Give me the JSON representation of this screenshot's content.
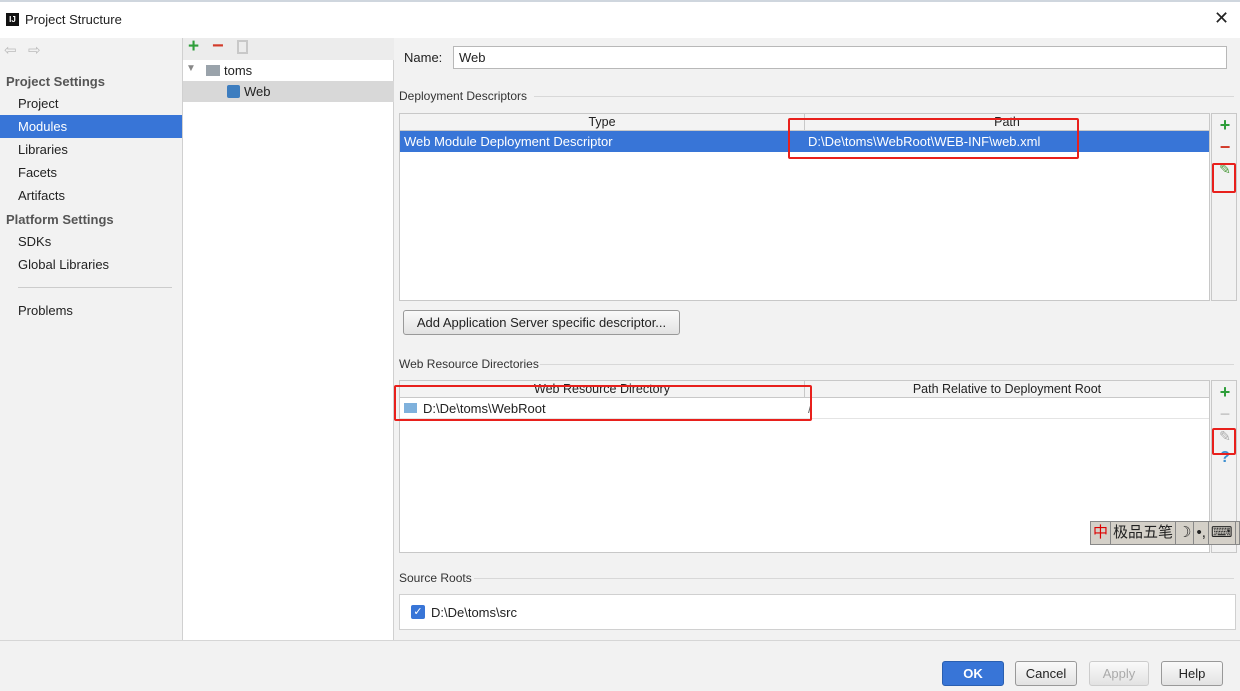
{
  "window": {
    "title": "Project Structure"
  },
  "sidebar": {
    "project_settings_header": "Project Settings",
    "project_items": [
      {
        "label": "Project"
      },
      {
        "label": "Modules",
        "selected": true
      },
      {
        "label": "Libraries"
      },
      {
        "label": "Facets"
      },
      {
        "label": "Artifacts"
      }
    ],
    "platform_settings_header": "Platform Settings",
    "platform_items": [
      {
        "label": "SDKs"
      },
      {
        "label": "Global Libraries"
      }
    ],
    "problems": "Problems"
  },
  "tree": {
    "root": "toms",
    "child": "Web"
  },
  "main": {
    "name_label": "Name:",
    "name_value": "Web",
    "deployment": {
      "header": "Deployment Descriptors",
      "columns": [
        "Type",
        "Path"
      ],
      "rows": [
        {
          "type": "Web Module Deployment Descriptor",
          "path": "D:\\De\\toms\\WebRoot\\WEB-INF\\web.xml"
        }
      ],
      "add_server_button": "Add Application Server specific descriptor..."
    },
    "resources": {
      "header": "Web Resource Directories",
      "columns": [
        "Web Resource Directory",
        "Path Relative to Deployment Root"
      ],
      "rows": [
        {
          "dir": "D:\\De\\toms\\WebRoot",
          "relative": "/"
        }
      ]
    },
    "source_roots": {
      "header": "Source Roots",
      "items": [
        {
          "path": "D:\\De\\toms\\src",
          "checked": true
        }
      ]
    }
  },
  "ime": {
    "items": [
      "中",
      "极品五笔",
      "☽",
      "•,",
      "⌨"
    ]
  },
  "footer": {
    "ok": "OK",
    "cancel": "Cancel",
    "apply": "Apply",
    "help": "Help"
  },
  "colors": {
    "selection": "#3875d7",
    "highlight": "#e8201c",
    "add": "#2e9e3a",
    "remove": "#d23b2a"
  }
}
